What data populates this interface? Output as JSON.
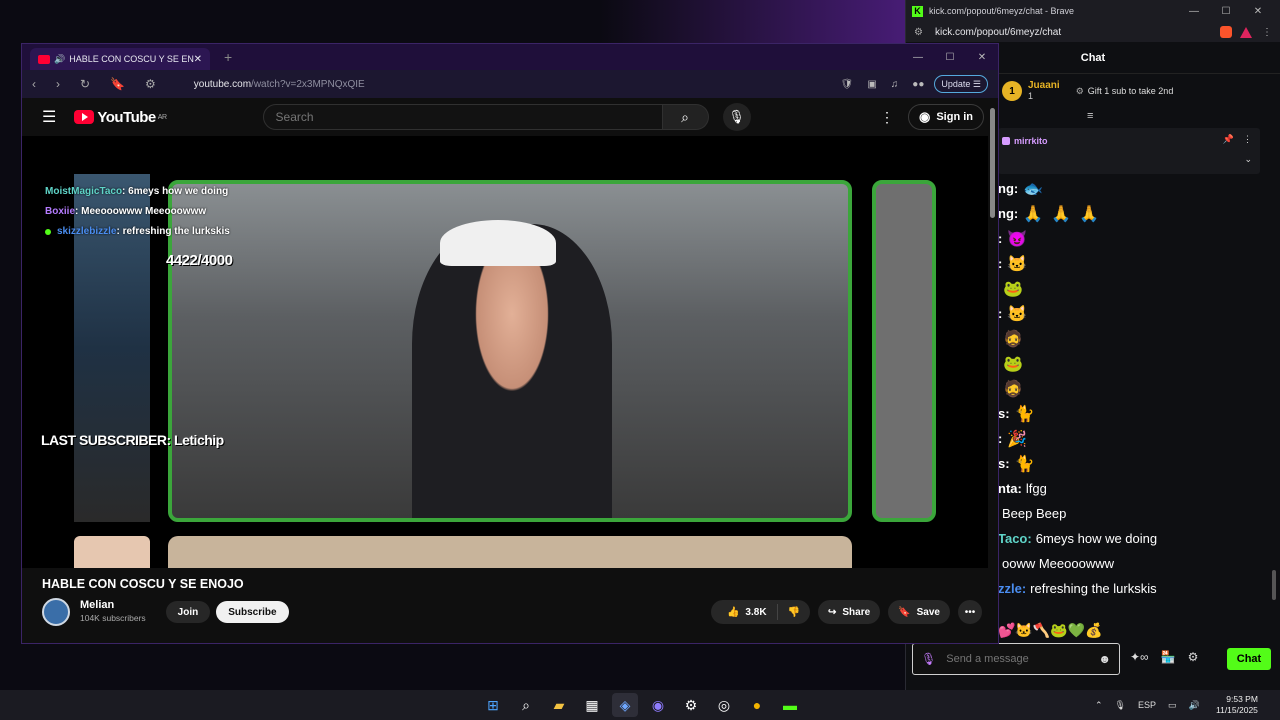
{
  "kick": {
    "window_title": "kick.com/popout/6meyz/chat - Brave",
    "url": "kick.com/popout/6meyz/chat",
    "chat_header": "Chat",
    "top_gifter": {
      "rank": "1",
      "name": "Juaani",
      "count": "1"
    },
    "gift_prompt": "Gift 1 sub to take 2nd",
    "pinned_user": "mirrkito",
    "messages": [
      {
        "user": "ng:",
        "user_color": "#ffffff",
        "text": "",
        "emotes": [
          "🐟"
        ]
      },
      {
        "user": "ng:",
        "user_color": "#ffffff",
        "text": "",
        "emotes": [
          "🙏",
          "🙏",
          "🙏"
        ]
      },
      {
        "user": ":",
        "user_color": "#ffffff",
        "text": "",
        "emotes": [
          "😈"
        ]
      },
      {
        "user": ":",
        "user_color": "#ffffff",
        "text": "",
        "emotes": [
          "🐱"
        ]
      },
      {
        "user": "",
        "user_color": "#ffffff",
        "text": "",
        "emotes": [
          "🐸"
        ]
      },
      {
        "user": ":",
        "user_color": "#ffffff",
        "text": "",
        "emotes": [
          "🐱"
        ]
      },
      {
        "user": "",
        "user_color": "#ffffff",
        "text": "",
        "emotes": [
          "🧔"
        ]
      },
      {
        "user": "",
        "user_color": "#ffffff",
        "text": "",
        "emotes": [
          "🐸"
        ]
      },
      {
        "user": "",
        "user_color": "#ffffff",
        "text": "",
        "emotes": [
          "🧔"
        ]
      },
      {
        "user": "s:",
        "user_color": "#ffffff",
        "text": "",
        "emotes": [
          "🐈"
        ]
      },
      {
        "user": ":",
        "user_color": "#ffffff",
        "text": "",
        "emotes": [
          "🎉"
        ]
      },
      {
        "user": "s:",
        "user_color": "#ffffff",
        "text": "",
        "emotes": [
          "🐈"
        ]
      },
      {
        "user": "nta:",
        "user_color": "#ffffff",
        "text": "lfgg",
        "emotes": []
      },
      {
        "user": "",
        "user_color": "#ffffff",
        "text": "Beep Beep",
        "emotes": []
      },
      {
        "user": "Taco:",
        "user_color": "#5fd4c8",
        "text": "6meys how we doing",
        "emotes": []
      },
      {
        "user": "",
        "user_color": "#ffffff",
        "text": "ooww Meeooowww",
        "emotes": []
      },
      {
        "user": "zzle:",
        "user_color": "#4a8df0",
        "text": "refreshing the lurkskis",
        "emotes": []
      }
    ],
    "emote_strip": "💕🐱🪓🐸💚💰",
    "input_placeholder": "Send a message",
    "send_label": "Chat"
  },
  "youtube": {
    "tab_title": "HABLE CON COSCU Y SE ENOJO",
    "url_main": "youtube.com",
    "url_rest": "/watch?v=2x3MPNQxQIE",
    "update_label": "Update",
    "logo_text": "YouTube",
    "logo_region": "AR",
    "search_placeholder": "Search",
    "signin_label": "Sign in",
    "overlay_chat": [
      {
        "user": "MoistMagicTaco",
        "color": "#5fd4c8",
        "text": ": 6meys how we doing",
        "badge": false
      },
      {
        "user": "Boxiie",
        "color": "#b57cff",
        "text": ": Meeooowww Meeooowww",
        "badge": false
      },
      {
        "user": "skizzlebizzle",
        "color": "#4a8df0",
        "text": ": refreshing the lurkskis",
        "badge": true
      }
    ],
    "goal": "4422/4000",
    "last_subscriber": "LAST SUBSCRIBER: Letichip",
    "video_title": "HABLE CON COSCU Y SE ENOJO",
    "channel_name": "Melian",
    "channel_subs": "104K subscribers",
    "join_label": "Join",
    "subscribe_label": "Subscribe",
    "likes": "3.8K",
    "share_label": "Share",
    "save_label": "Save"
  },
  "taskbar": {
    "language": "ESP",
    "time": "9:53 PM",
    "date": "11/15/2025"
  }
}
